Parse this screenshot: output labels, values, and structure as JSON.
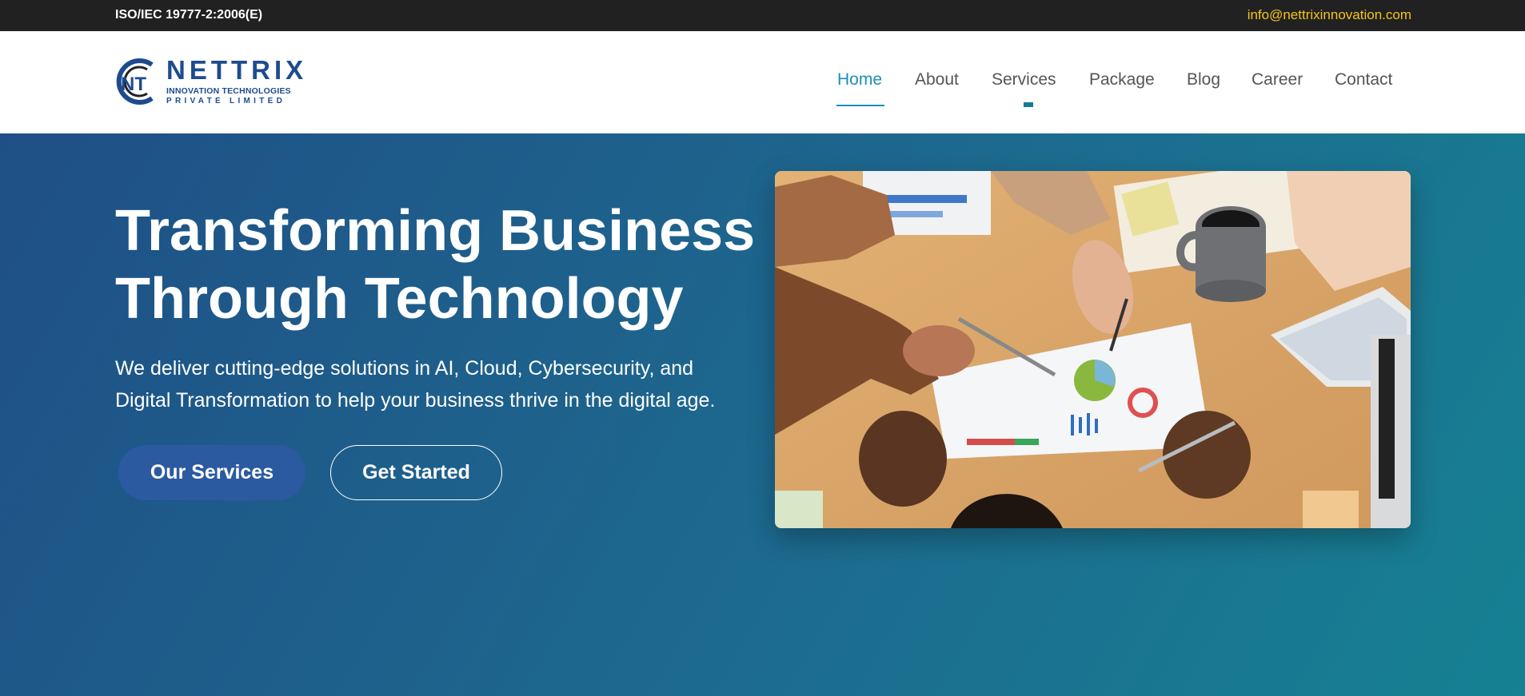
{
  "topbar": {
    "certification": "ISO/IEC 19777-2:2006(E)",
    "email": "info@nettrixinnovation.com"
  },
  "logo": {
    "initials": "NT",
    "wordmark": "NETTRIX",
    "line1": "INNOVATION TECHNOLOGIES",
    "line2": "PRIVATE LIMITED",
    "colors": {
      "primary": "#1e4b8f",
      "ring": "#1e4b8f"
    }
  },
  "nav": {
    "items": [
      {
        "label": "Home",
        "active": true
      },
      {
        "label": "About"
      },
      {
        "label": "Services"
      },
      {
        "label": "Package"
      },
      {
        "label": "Blog"
      },
      {
        "label": "Career"
      },
      {
        "label": "Contact"
      }
    ]
  },
  "hero": {
    "title_line1": "Transforming Business",
    "title_line2": "Through Technology",
    "description_line1": "We deliver cutting-edge solutions in AI, Cloud, Cybersecurity, and",
    "description_line2": "Digital Transformation to help your business thrive in the digital age.",
    "primary_button": "Our Services",
    "secondary_button": "Get Started",
    "image_label": "team-meeting-photo"
  },
  "colors": {
    "topbar_bg": "#212121",
    "email_color": "#f5c518",
    "nav_active": "#1b8fb8",
    "hero_gradient_start": "#1f4f86",
    "hero_gradient_end": "#168193",
    "primary_button_bg": "#2c5aa0"
  }
}
